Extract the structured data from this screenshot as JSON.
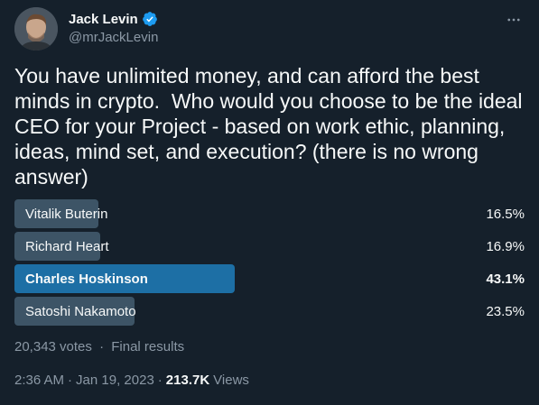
{
  "author": {
    "display_name": "Jack Levin",
    "handle": "@mrJackLevin",
    "verified": true,
    "verified_color": "#1d9bf0"
  },
  "tweet": {
    "text": "You have unlimited money, and can afford the best minds in crypto.  Who would you choose to be the ideal CEO for your Project - based on work ethic, planning, ideas, mind set, and execution? (there is no wrong answer)"
  },
  "poll": {
    "options": [
      {
        "label": "Vitalik Buterin",
        "percent_text": "16.5%",
        "percent": 16.5,
        "winner": false
      },
      {
        "label": "Richard Heart",
        "percent_text": "16.9%",
        "percent": 16.9,
        "winner": false
      },
      {
        "label": "Charles Hoskinson",
        "percent_text": "43.1%",
        "percent": 43.1,
        "winner": true
      },
      {
        "label": "Satoshi Nakamoto",
        "percent_text": "23.5%",
        "percent": 23.5,
        "winner": false
      }
    ],
    "votes_text": "20,343 votes",
    "separator": "·",
    "status": "Final results",
    "bar_color": "#3d5466",
    "winner_bar_color": "#1d6fa5"
  },
  "meta": {
    "time": "2:36 AM",
    "separator": "·",
    "date": "Jan 19, 2023",
    "views_count": "213.7K",
    "views_label": "Views"
  },
  "icons": {
    "more": "more-horizontal-icon",
    "verified": "verified-badge-icon"
  }
}
